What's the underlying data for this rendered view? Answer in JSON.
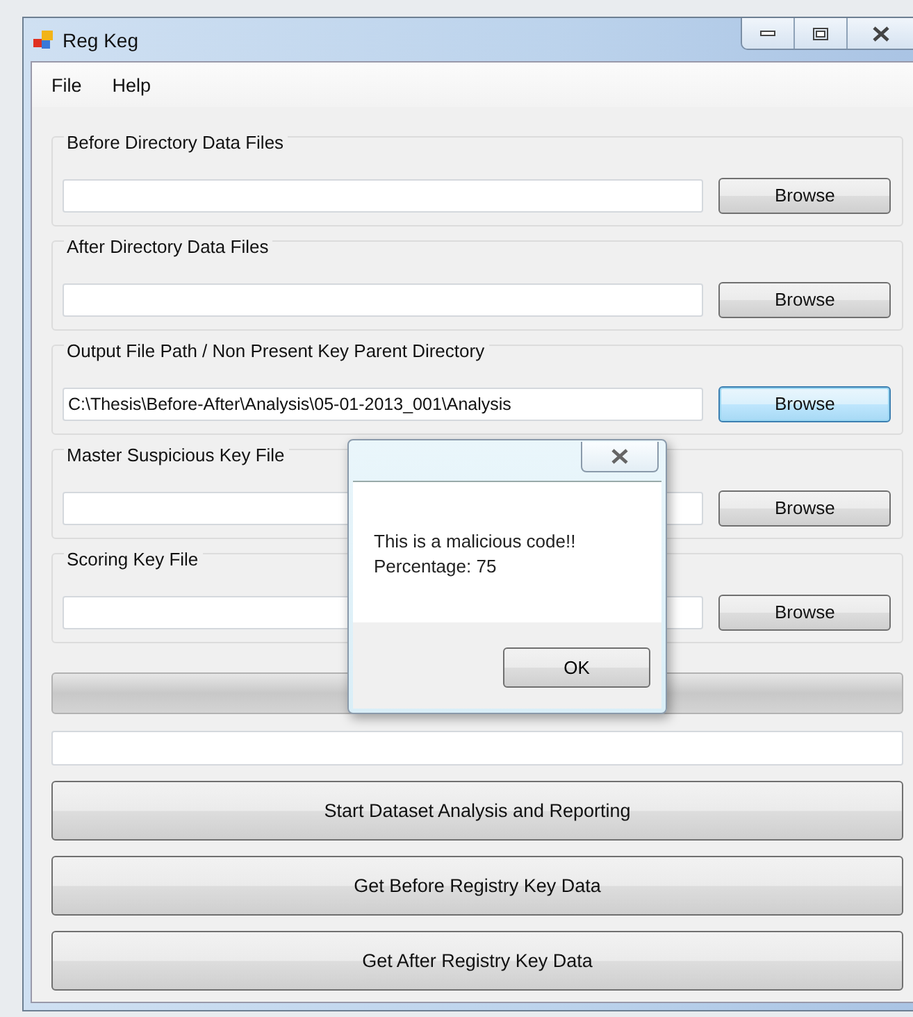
{
  "window": {
    "title": "Reg Keg"
  },
  "menu": [
    {
      "label": "File"
    },
    {
      "label": "Help"
    }
  ],
  "groups": [
    {
      "label": "Before Directory Data Files",
      "button": "Browse",
      "focused": false
    },
    {
      "label": "After Directory Data Files",
      "button": "Browse",
      "focused": false
    },
    {
      "label": "Output File Path / Non Present Key Parent Directory",
      "value": "C:\\Thesis\\Before-After\\Analysis\\05-01-2013_001\\Analysis",
      "button": "Browse",
      "focused": true
    },
    {
      "label": "Master Suspicious Key File",
      "button": "Browse",
      "focused": false
    },
    {
      "label": "Scoring Key File",
      "button": "Browse",
      "focused": false
    }
  ],
  "progress": {
    "level": 0
  },
  "actions": [
    "Start Dataset Analysis and Reporting",
    "Get Before Registry Key Data",
    "Get After Registry Key Data"
  ],
  "dialog": {
    "message_lines": [
      "This is a malicious code!!",
      "Percentage: 75"
    ],
    "button": "OK"
  }
}
